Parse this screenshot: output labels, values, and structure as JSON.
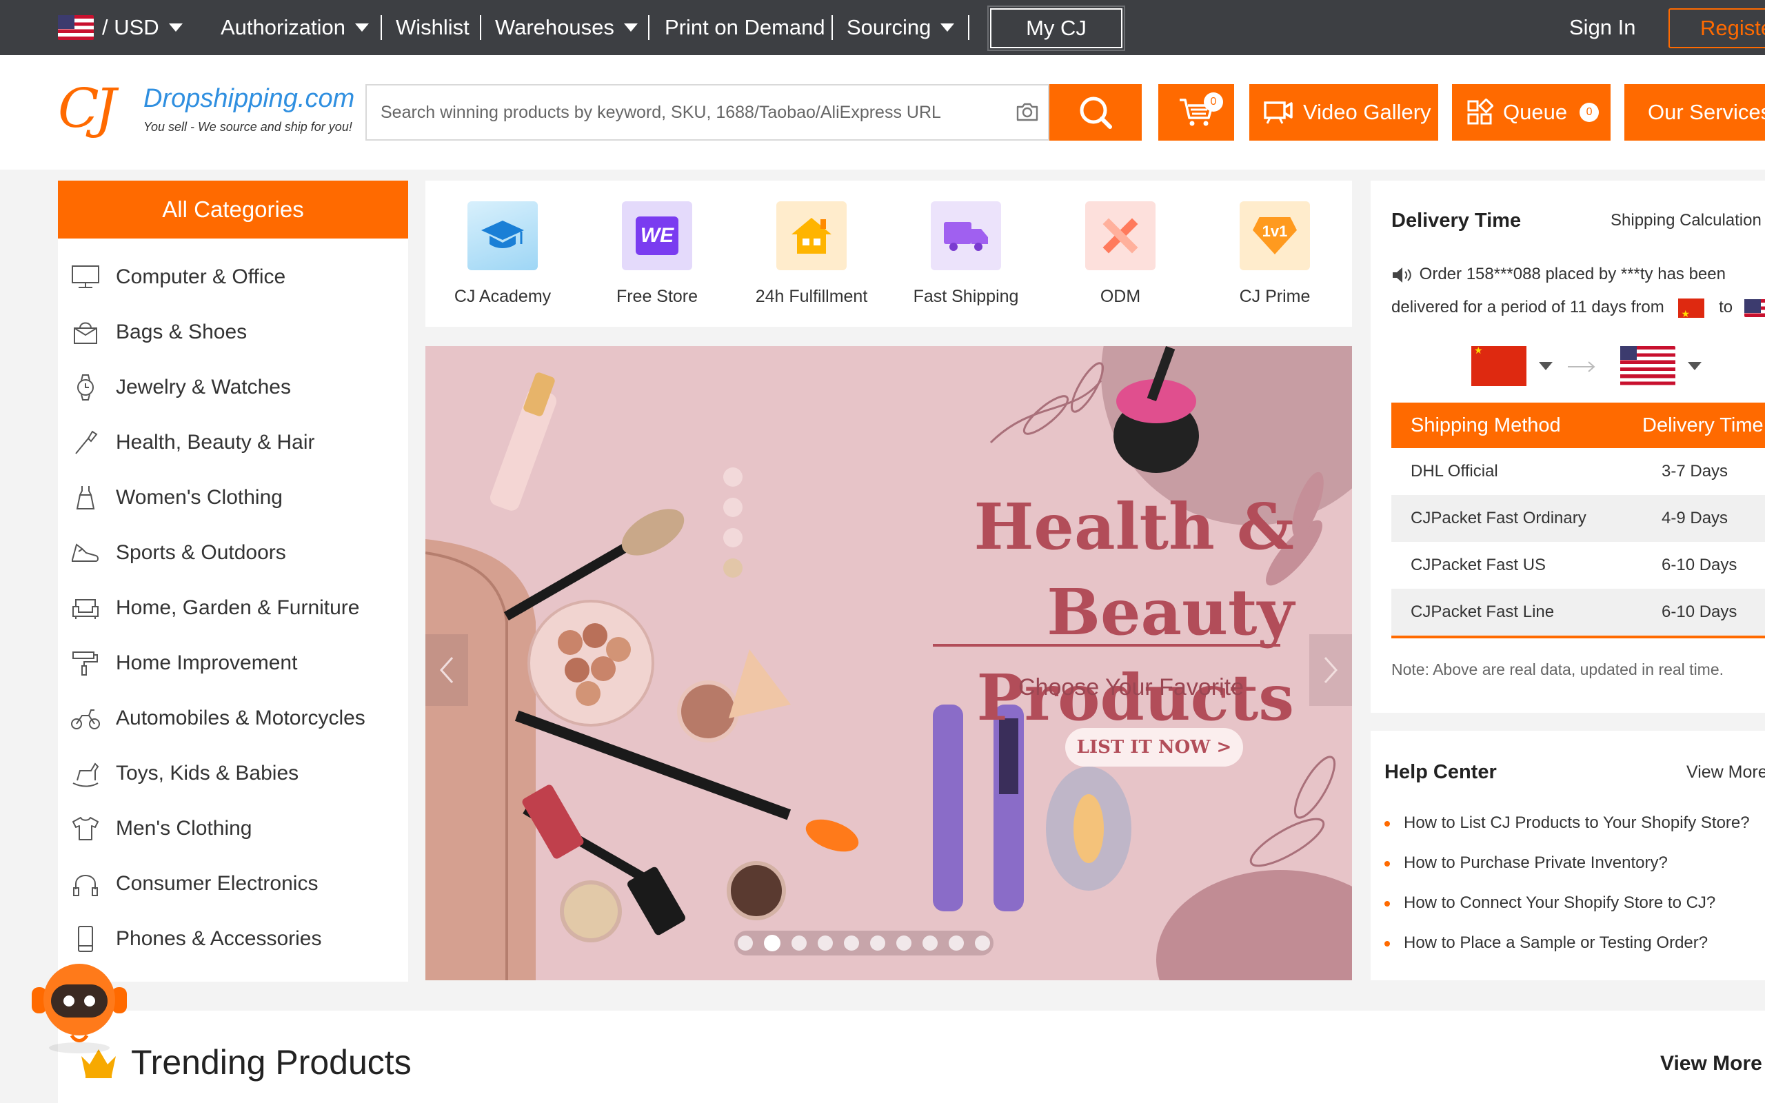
{
  "topbar": {
    "currency": "/ USD",
    "nav": [
      "Authorization",
      "Wishlist",
      "Warehouses",
      "Print on Demand",
      "Sourcing"
    ],
    "my_cj": "My CJ",
    "sign_in": "Sign In",
    "register": "Register"
  },
  "header": {
    "logo_domain": "Dropshipping.com",
    "logo_tagline": "You sell - We source and ship for you!",
    "search_placeholder": "Search winning products by keyword, SKU, 1688/Taobao/AliExpress URL",
    "cart_count": "0",
    "video_gallery": "Video Gallery",
    "queue": "Queue",
    "queue_count": "0",
    "our_services": "Our Services"
  },
  "sidebar": {
    "title": "All Categories",
    "items": [
      {
        "label": "Computer & Office",
        "icon": "monitor-icon"
      },
      {
        "label": "Bags & Shoes",
        "icon": "bag-icon"
      },
      {
        "label": "Jewelry & Watches",
        "icon": "watch-icon"
      },
      {
        "label": "Health, Beauty & Hair",
        "icon": "brush-icon"
      },
      {
        "label": "Women's Clothing",
        "icon": "dress-icon"
      },
      {
        "label": "Sports & Outdoors",
        "icon": "sneaker-icon"
      },
      {
        "label": "Home, Garden & Furniture",
        "icon": "sofa-icon"
      },
      {
        "label": "Home Improvement",
        "icon": "paint-roller-icon"
      },
      {
        "label": "Automobiles & Motorcycles",
        "icon": "motorcycle-icon"
      },
      {
        "label": "Toys, Kids & Babies",
        "icon": "rocking-horse-icon"
      },
      {
        "label": "Men's Clothing",
        "icon": "tshirt-icon"
      },
      {
        "label": "Consumer Electronics",
        "icon": "headphones-icon"
      },
      {
        "label": "Phones & Accessories",
        "icon": "phone-icon"
      }
    ]
  },
  "quick_links": [
    {
      "label": "CJ Academy",
      "icon": "graduation-cap-icon"
    },
    {
      "label": "Free Store",
      "icon": "we-store-icon",
      "icon_text": "WE"
    },
    {
      "label": "24h Fulfillment",
      "icon": "house-icon"
    },
    {
      "label": "Fast Shipping",
      "icon": "truck-icon"
    },
    {
      "label": "ODM",
      "icon": "ruler-pencil-icon"
    },
    {
      "label": "CJ Prime",
      "icon": "diamond-icon",
      "icon_text": "1v1"
    }
  ],
  "banner": {
    "title_line1": "Health & Beauty",
    "title_line2": "Products",
    "subtitle": "Choose Your Favorite",
    "cta": "LIST IT NOW >",
    "slide_count": 10,
    "active_slide": 2
  },
  "delivery": {
    "title": "Delivery Time",
    "calc_link": "Shipping Calculation",
    "message_part1": "Order 158***088 placed by ***ty has been delivered for a period of 11 days from",
    "message_to": "to",
    "columns": [
      "Shipping Method",
      "Delivery Time"
    ],
    "rows": [
      {
        "method": "DHL Official",
        "time": "3-7 Days"
      },
      {
        "method": "CJPacket Fast Ordinary",
        "time": "4-9 Days"
      },
      {
        "method": "CJPacket Fast US",
        "time": "6-10 Days"
      },
      {
        "method": "CJPacket Fast Line",
        "time": "6-10 Days"
      }
    ],
    "note": "Note: Above are real data, updated in real time."
  },
  "help": {
    "title": "Help Center",
    "view_more": "View More",
    "items": [
      "How to List CJ Products to Your Shopify Store?",
      "How to Purchase Private Inventory?",
      "How to Connect Your Shopify Store to CJ?",
      "How to Place a Sample or Testing Order?"
    ]
  },
  "trending": {
    "title": "Trending Products",
    "view_more": "View More"
  },
  "colors": {
    "accent": "#ff6a00",
    "topbar": "#3d3f43",
    "banner_title": "#b24d59"
  }
}
